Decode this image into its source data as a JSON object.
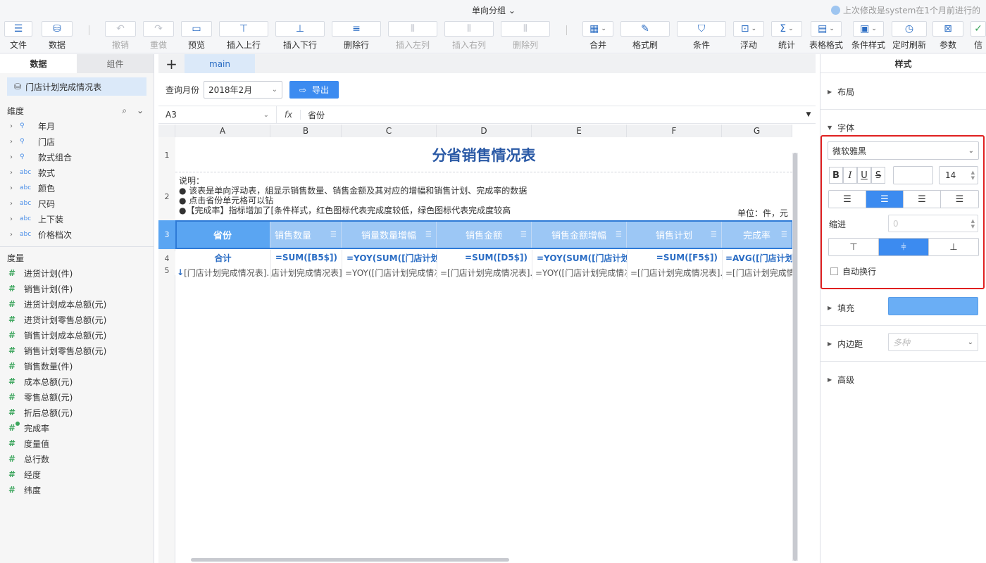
{
  "titlebar": {
    "title": "单向分组 ⌄",
    "last_modified": "上次修改是system在1个月前进行的"
  },
  "toolbar": {
    "file": "文件",
    "data": "数据",
    "undo": "撤销",
    "redo": "重做",
    "preview": "预览",
    "insert_row_above": "插入上行",
    "insert_row_below": "插入下行",
    "delete_row": "删除行",
    "insert_col_left": "插入左列",
    "insert_col_right": "插入右列",
    "delete_col": "删除列",
    "merge": "合并",
    "format_painter": "格式刷",
    "condition": "条件",
    "float": "浮动",
    "stats": "统计",
    "table_format": "表格格式",
    "condition_style": "条件样式",
    "timed_refresh": "定时刷新",
    "params": "参数",
    "more": "信"
  },
  "left": {
    "tab_data": "数据",
    "tab_component": "组件",
    "dataset": "门店计划完成情况表",
    "dim_title": "维度",
    "dimensions": [
      {
        "type": "geo",
        "label": "年月"
      },
      {
        "type": "geo",
        "label": "门店"
      },
      {
        "type": "geo",
        "label": "款式组合"
      },
      {
        "type": "abc",
        "label": "款式"
      },
      {
        "type": "abc",
        "label": "颜色"
      },
      {
        "type": "abc",
        "label": "尺码"
      },
      {
        "type": "abc",
        "label": "上下装"
      },
      {
        "type": "abc",
        "label": "价格档次"
      }
    ],
    "mea_title": "度量",
    "measures": [
      "进货计划(件)",
      "销售计划(件)",
      "进货计划成本总额(元)",
      "进货计划零售总额(元)",
      "销售计划成本总额(元)",
      "销售计划零售总额(元)",
      "销售数量(件)",
      "成本总额(元)",
      "零售总额(元)",
      "折后总额(元)",
      "完成率",
      "度量值",
      "总行数",
      "经度",
      "纬度"
    ]
  },
  "sheet": {
    "tab": "main",
    "param_label": "查询月份",
    "param_value": "2018年2月",
    "export": "导出",
    "cell_ref": "A3",
    "fx": "fx",
    "formula": "省份",
    "col_headers": [
      "A",
      "B",
      "C",
      "D",
      "E",
      "F",
      "G"
    ],
    "row_numbers": [
      "1",
      "2",
      "3",
      "4",
      "5"
    ],
    "title": "分省销售情况表",
    "note_lines": [
      "说明：",
      "●  该表是单向浮动表，組显示销售数量、销售金额及其对应的增幅和销售计划、完成率的数据",
      "●  点击省份单元格可以钻",
      "●【完成率】指标增加了[条件样式，红色图标代表完成度较低，绿色图标代表完成度较高"
    ],
    "unit": "单位：件，元",
    "headers": [
      "省份",
      "销售数量",
      "销量数量增幅",
      "销售金额",
      "销售金额增幅",
      "销售计划",
      "完成率"
    ],
    "row4": [
      "合计",
      "=SUM([B5$])",
      "=YOY(SUM([门店计划完",
      "=SUM([D5$])",
      "=YOY(SUM([门店计划完",
      "=SUM([F5$])",
      "=AVG([门店计划完"
    ],
    "row5": [
      "[门店计划完成情况表].",
      "店计划完成情况表].",
      "=YOY([门店计划完成情况",
      "=[门店计划完成情况表].",
      "=YOY([门店计划完成情况",
      "=[门店计划完成情况表].",
      "=[门店计划完成情况"
    ]
  },
  "right": {
    "title": "样式",
    "layout": "布局",
    "font": "字体",
    "font_family": "微软雅黑",
    "bold": "B",
    "italic": "I",
    "underline": "U",
    "strike": "S",
    "font_size": "14",
    "indent": "缩进",
    "indent_value": "0",
    "auto_wrap": "自动换行",
    "fill": "填充",
    "padding": "内边距",
    "padding_value": "多种",
    "advanced": "高级",
    "fill_color": "#6aaef5"
  }
}
